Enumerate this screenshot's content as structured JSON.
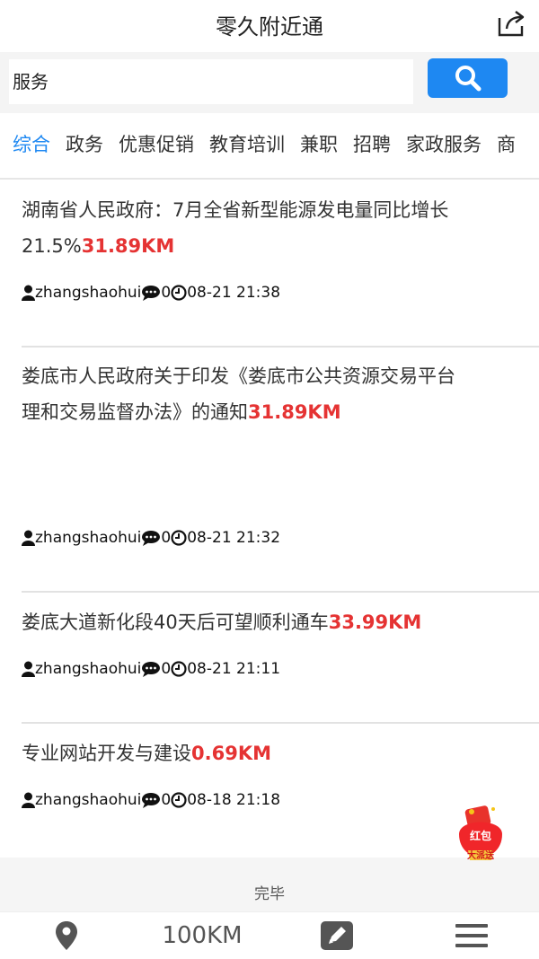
{
  "header": {
    "title": "零久附近通",
    "share_icon": "share-icon"
  },
  "search": {
    "value": "服务",
    "button_icon": "search-icon"
  },
  "categories": [
    {
      "label": "综合",
      "active": true
    },
    {
      "label": "政务"
    },
    {
      "label": "优惠促销"
    },
    {
      "label": "教育培训"
    },
    {
      "label": "兼职"
    },
    {
      "label": "招聘"
    },
    {
      "label": "家政服务"
    },
    {
      "label": "商"
    }
  ],
  "items": [
    {
      "title_line1": "湖南省人民政府：7月全省新型能源发电量同比增长",
      "title_line2": "21.5%",
      "distance": "31.89KM",
      "author": "zhangshaohui",
      "comments": "0",
      "time": "08-21 21:38"
    },
    {
      "title_line1": "娄底市人民政府关于印发《娄底市公共资源交易平台",
      "title_line2": "理和交易监督办法》的通知",
      "distance": "31.89KM",
      "author": "zhangshaohui",
      "comments": "0",
      "time": "08-21 21:32"
    },
    {
      "title_line1": "娄底大道新化段40天后可望顺利通车",
      "distance": "33.99KM",
      "author": "zhangshaohui",
      "comments": "0",
      "time": "08-21 21:11"
    },
    {
      "title_line1": "专业网站开发与建设",
      "distance": "0.69KM",
      "author": "zhangshaohui",
      "comments": "0",
      "time": "08-18 21:18"
    }
  ],
  "footer": {
    "done_label": "完毕"
  },
  "redpacket": {
    "line1": "红包",
    "line2": "大派送"
  },
  "tabbar": {
    "range_label": "100KM"
  },
  "colors": {
    "accent": "#1e88f2",
    "distance": "#e53333"
  }
}
